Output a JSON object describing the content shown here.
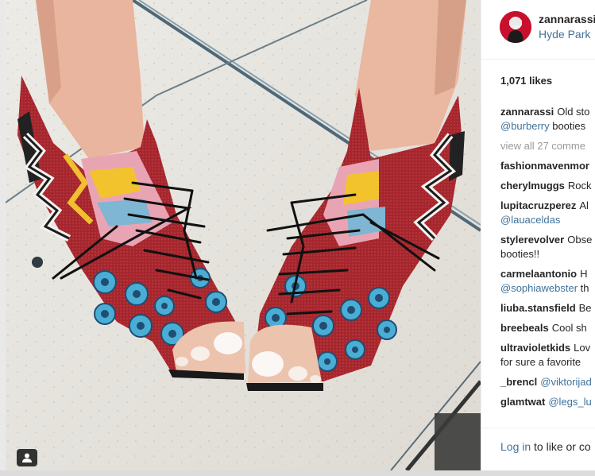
{
  "post": {
    "username": "zannarassi",
    "location": "Hyde Park",
    "likes": "1,071 likes"
  },
  "comments": {
    "caption": {
      "author": "zannarassi",
      "text": "Old sto",
      "mention": "@burberry",
      "rest": " booties"
    },
    "view_all": "view all 27 comme",
    "items": [
      {
        "author": "fashionmavenmor",
        "text": ""
      },
      {
        "author": "cherylmuggs",
        "text": "Rock"
      },
      {
        "author": "lupitacruzperez",
        "text": "Al",
        "mention": "@lauaceldas"
      },
      {
        "author": "stylerevolver",
        "text": "Obse",
        "line2": "booties!!"
      },
      {
        "author": "carmelaantonio",
        "text": "H",
        "mention": "@sophiawebster",
        "rest": " th"
      },
      {
        "author": "liuba.stansfield",
        "text": "Be"
      },
      {
        "author": "breebeals",
        "text": "Cool sh"
      },
      {
        "author": "ultravioletkids",
        "text": "Lov",
        "line2": "for sure a favorite"
      },
      {
        "author": "_brencl",
        "text": "",
        "mention": "@viktorijad"
      },
      {
        "author": "glamtwat",
        "text": "",
        "mention": "@legs_lu"
      }
    ]
  },
  "footer": {
    "login_link": "Log in",
    "login_rest": " to like or co"
  },
  "colors": {
    "link": "#3f729b",
    "text": "#262626",
    "muted": "#999999"
  },
  "icons": {
    "user_tag": "person-tag-icon"
  }
}
